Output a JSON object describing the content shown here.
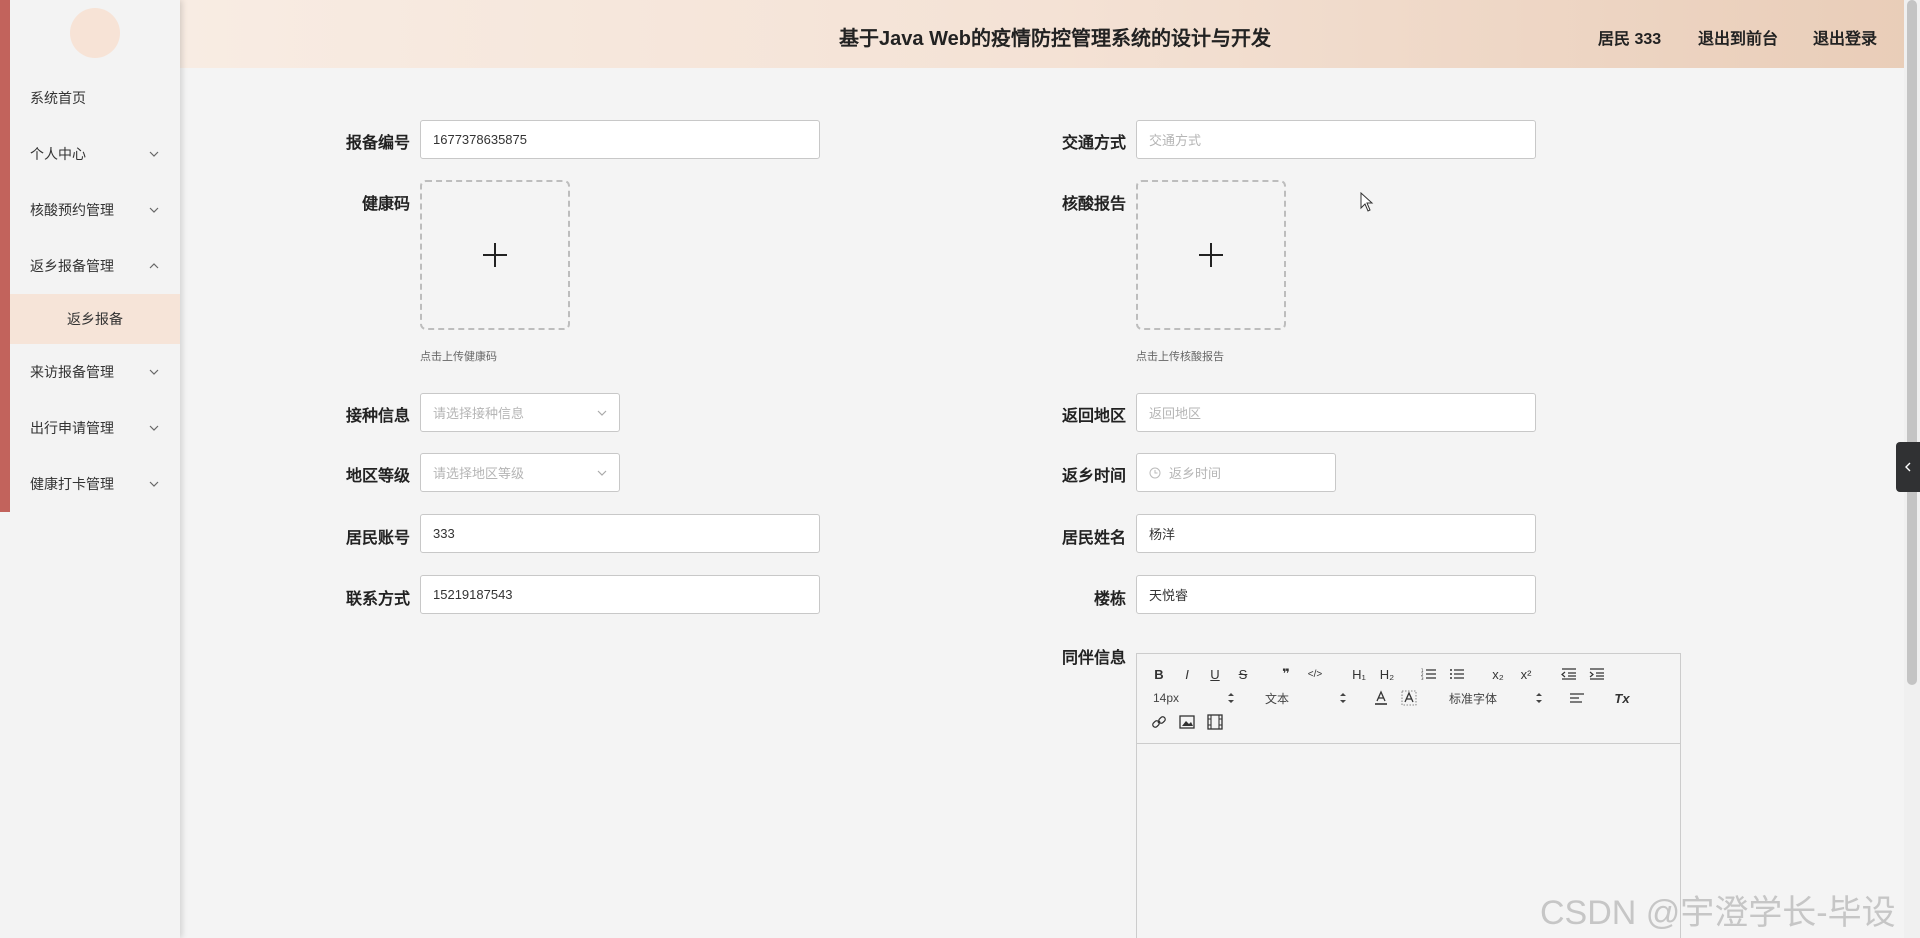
{
  "header": {
    "title": "基于Java Web的疫情防控管理系统的设计与开发",
    "user": "居民 333",
    "link_front": "退出到前台",
    "link_logout": "退出登录"
  },
  "sidebar": {
    "items": [
      {
        "label": "系统首页"
      },
      {
        "label": "个人中心"
      },
      {
        "label": "核酸预约管理"
      },
      {
        "label": "返乡报备管理"
      },
      {
        "label": "来访报备管理"
      },
      {
        "label": "出行申请管理"
      },
      {
        "label": "健康打卡管理"
      }
    ],
    "submenu": {
      "label": "返乡报备"
    }
  },
  "form": {
    "report_no": {
      "label": "报备编号",
      "value": "1677378635875"
    },
    "health_code": {
      "label": "健康码",
      "hint": "点击上传健康码"
    },
    "vaccine": {
      "label": "接种信息",
      "placeholder": "请选择接种信息"
    },
    "region_level": {
      "label": "地区等级",
      "placeholder": "请选择地区等级"
    },
    "account": {
      "label": "居民账号",
      "value": "333"
    },
    "contact": {
      "label": "联系方式",
      "value": "15219187543"
    },
    "transport": {
      "label": "交通方式",
      "placeholder": "交通方式"
    },
    "nucleic_report": {
      "label": "核酸报告",
      "hint": "点击上传核酸报告"
    },
    "return_region": {
      "label": "返回地区",
      "placeholder": "返回地区"
    },
    "return_time": {
      "label": "返乡时间",
      "placeholder": "返乡时间"
    },
    "name": {
      "label": "居民姓名",
      "value": "杨洋"
    },
    "building": {
      "label": "楼栋",
      "value": "天悦睿"
    },
    "companion": {
      "label": "同伴信息"
    }
  },
  "editor": {
    "bold": "B",
    "italic": "I",
    "underline": "U",
    "strike": "S",
    "quote": "❞",
    "code": "</>",
    "h1": "H₁",
    "h2": "H₂",
    "sub": "x₂",
    "sup": "x²",
    "font_size": "14px",
    "text_type": "文本",
    "font_family": "标准字体",
    "clean": "Tx"
  },
  "watermark": "CSDN @宇澄学长-毕设",
  "colors": {
    "accent": "#c2635c",
    "submenu_bg": "#f6e4d8",
    "header_from": "#f8ece3",
    "header_to": "#e9cdb8"
  }
}
